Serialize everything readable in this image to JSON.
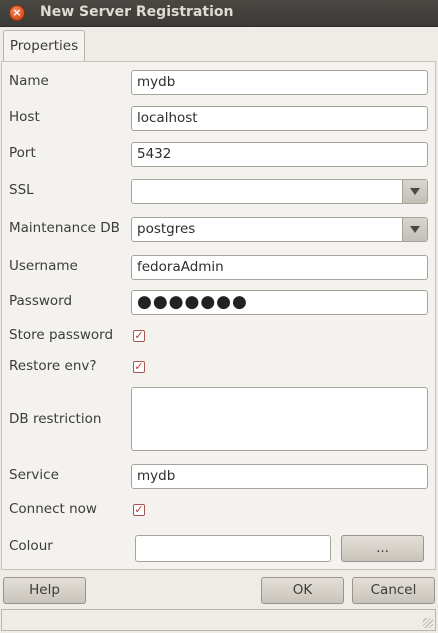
{
  "window": {
    "title": "New Server Registration",
    "close_icon": "close-icon"
  },
  "tabs": [
    {
      "label": "Properties",
      "active": true
    }
  ],
  "form": {
    "name": {
      "label": "Name",
      "value": "mydb"
    },
    "host": {
      "label": "Host",
      "value": "localhost"
    },
    "port": {
      "label": "Port",
      "value": "5432"
    },
    "ssl": {
      "label": "SSL",
      "value": ""
    },
    "maintenance_db": {
      "label": "Maintenance DB",
      "value": "postgres"
    },
    "username": {
      "label": "Username",
      "value": "fedoraAdmin"
    },
    "password": {
      "label": "Password",
      "masked": "●●●●●●●"
    },
    "store_password": {
      "label": "Store password",
      "checked": true
    },
    "restore_env": {
      "label": "Restore env?",
      "checked": true
    },
    "db_restriction": {
      "label": "DB restriction",
      "value": ""
    },
    "service": {
      "label": "Service",
      "value": "mydb"
    },
    "connect_now": {
      "label": "Connect now",
      "checked": true
    },
    "colour": {
      "label": "Colour",
      "value": "",
      "picker_label": "..."
    }
  },
  "buttons": {
    "help": "Help",
    "ok": "OK",
    "cancel": "Cancel"
  },
  "colors": {
    "accent": "#d64f1e",
    "checkmark": "#c03a2b"
  }
}
